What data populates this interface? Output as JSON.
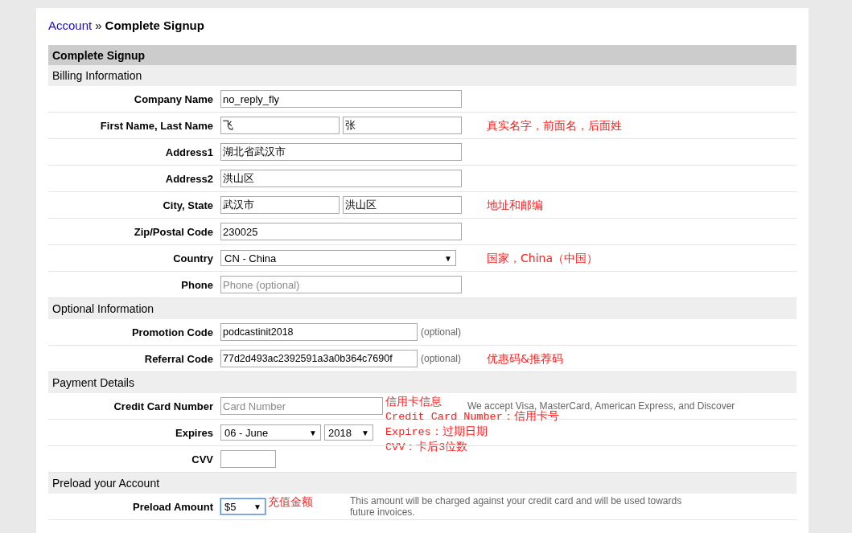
{
  "breadcrumb": {
    "link": "Account",
    "separator": "»",
    "current": "Complete Signup"
  },
  "panel_title": "Complete Signup",
  "sections": [
    {
      "title": "Billing Information",
      "rows": [
        {
          "label": "Company Name",
          "controls": [
            {
              "kind": "text",
              "value": "no_reply_fly"
            }
          ]
        },
        {
          "label": "First Name, Last Name",
          "controls": [
            {
              "kind": "text",
              "value": "飞"
            },
            {
              "kind": "text",
              "value": "张"
            }
          ],
          "annotation": [
            "真实名字，前面名，后面姓"
          ]
        },
        {
          "label": "Address1",
          "controls": [
            {
              "kind": "text",
              "value": "湖北省武汉市"
            }
          ]
        },
        {
          "label": "Address2",
          "controls": [
            {
              "kind": "text",
              "value": "洪山区"
            }
          ]
        },
        {
          "label": "City, State",
          "controls": [
            {
              "kind": "text",
              "value": "武汉市"
            },
            {
              "kind": "text",
              "value": "洪山区"
            }
          ],
          "annotation": [
            "地址和邮编"
          ]
        },
        {
          "label": "Zip/Postal Code",
          "controls": [
            {
              "kind": "text",
              "value": "230025"
            }
          ]
        },
        {
          "label": "Country",
          "controls": [
            {
              "kind": "select",
              "value": "CN - China",
              "arrow": "▼"
            }
          ],
          "annotation": [
            "国家，China（中国）"
          ]
        },
        {
          "label": "Phone",
          "controls": [
            {
              "kind": "text",
              "placeholder": "Phone (optional)"
            }
          ]
        }
      ]
    },
    {
      "title": "Optional Information",
      "rows": [
        {
          "label": "Promotion Code",
          "controls": [
            {
              "kind": "code",
              "value": "podcastinit2018"
            }
          ],
          "note": "(optional)"
        },
        {
          "label": "Referral Code",
          "controls": [
            {
              "kind": "code",
              "value": "77d2d493ac2392591a3a0b364c7690f"
            }
          ],
          "note": "(optional)",
          "annotation": [
            "优惠码&推荐码"
          ]
        }
      ]
    },
    {
      "title": "Payment Details",
      "rows": [
        {
          "label": "Credit Card Number",
          "controls": [
            {
              "kind": "card",
              "placeholder": "Card Number"
            }
          ],
          "annotation": [
            "信用卡信息",
            "Credit Card Number：信用卡号",
            "Expires：过期日期",
            "CVV：卡后3位数"
          ],
          "help": "We accept Visa, MasterCard, American Express, and Discover"
        },
        {
          "label": "Expires",
          "controls": [
            {
              "kind": "month",
              "value": "06 - June",
              "arrow": "▼"
            },
            {
              "kind": "year",
              "value": "2018",
              "arrow": "▼"
            }
          ]
        },
        {
          "label": "CVV",
          "controls": [
            {
              "kind": "short"
            }
          ]
        }
      ]
    },
    {
      "title": "Preload your Account",
      "rows": [
        {
          "label": "Preload Amount",
          "controls": [
            {
              "kind": "amount",
              "value": "$5",
              "arrow": "▼",
              "focused": true
            }
          ],
          "annotation": [
            "充值金额"
          ],
          "help": "This amount will be charged against your credit card and will be used towards future invoices."
        }
      ]
    }
  ]
}
